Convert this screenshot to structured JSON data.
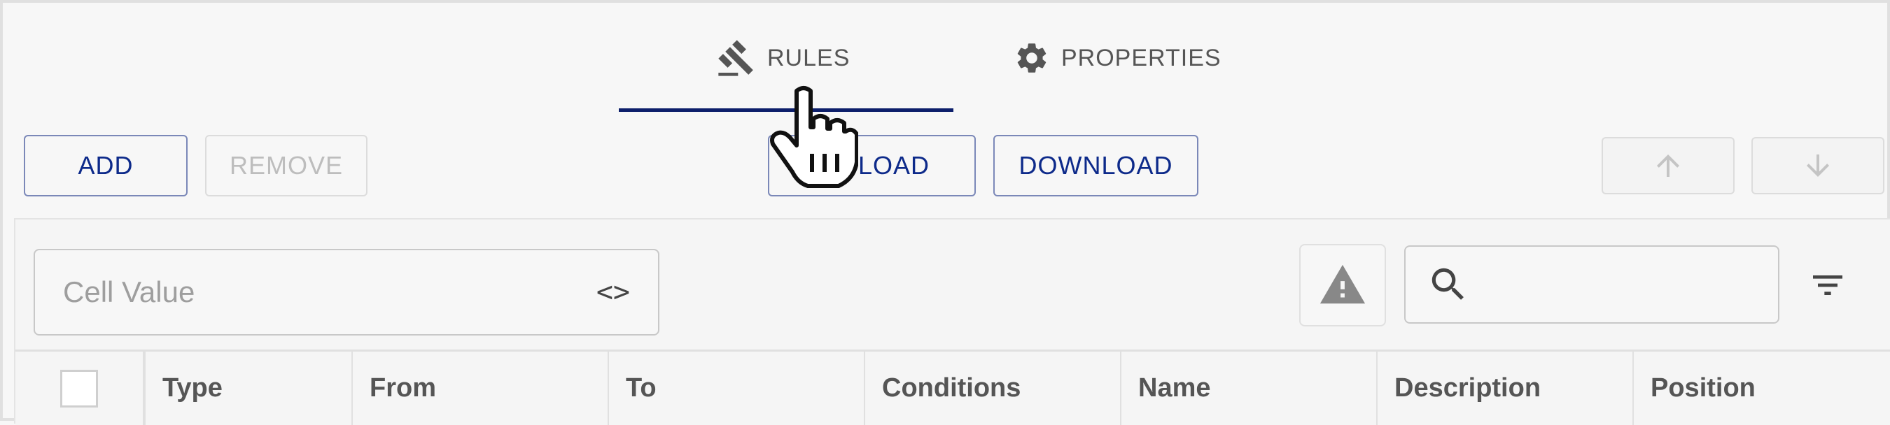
{
  "tabs": [
    {
      "label": "RULES",
      "icon": "gavel-icon",
      "active": true
    },
    {
      "label": "PROPERTIES",
      "icon": "gear-icon",
      "active": false
    }
  ],
  "toolbar": {
    "add_label": "ADD",
    "remove_label": "REMOVE",
    "upload_label": "LOAD",
    "download_label": "DOWNLOAD",
    "move_up_icon": "arrow-up-icon",
    "move_down_icon": "arrow-down-icon"
  },
  "filter": {
    "cell_value_placeholder": "Cell Value",
    "code_icon": "code-icon",
    "warning_icon": "warning-icon",
    "search_icon": "search-icon",
    "search_value": "",
    "filter_icon": "filter-icon"
  },
  "table": {
    "columns": [
      "Type",
      "From",
      "To",
      "Conditions",
      "Name",
      "Description",
      "Position"
    ]
  },
  "colors": {
    "accent": "#0d2a8a",
    "tab_underline": "#0d1f6b"
  }
}
